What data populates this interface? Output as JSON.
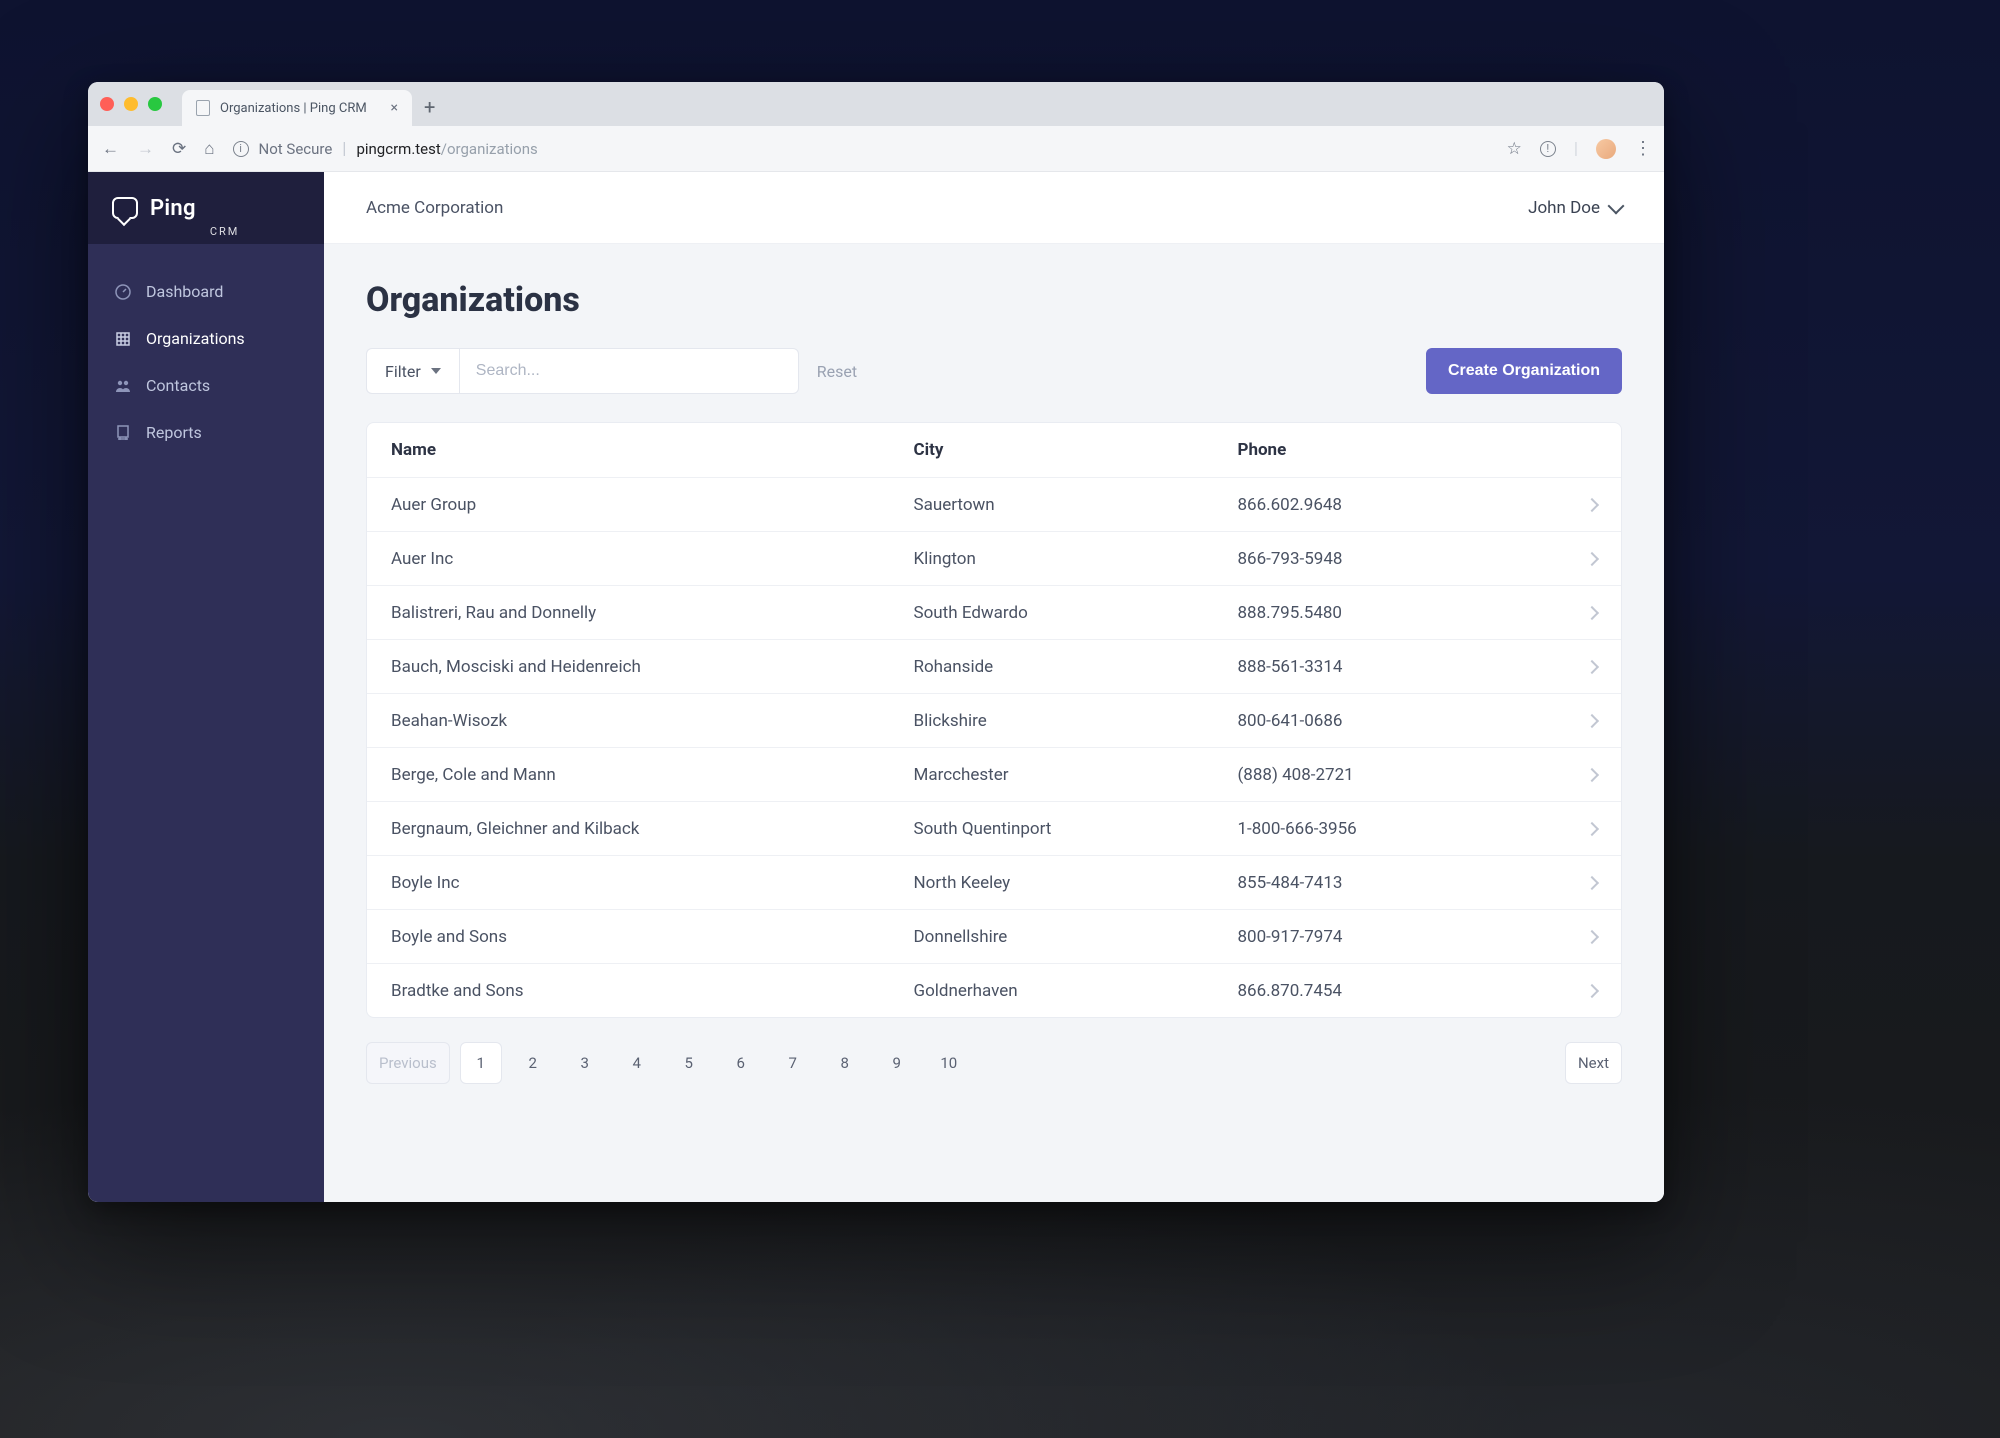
{
  "browser": {
    "tab_title": "Organizations | Ping CRM",
    "not_secure_label": "Not Secure",
    "url_host": "pingcrm.test",
    "url_path": "/organizations"
  },
  "brand": {
    "name": "Ping",
    "suffix": "CRM"
  },
  "sidebar": {
    "items": [
      {
        "label": "Dashboard"
      },
      {
        "label": "Organizations"
      },
      {
        "label": "Contacts"
      },
      {
        "label": "Reports"
      }
    ]
  },
  "topbar": {
    "account": "Acme Corporation",
    "user": "John Doe"
  },
  "page": {
    "title": "Organizations",
    "filter_label": "Filter",
    "search_placeholder": "Search...",
    "reset_label": "Reset",
    "create_label": "Create Organization"
  },
  "table": {
    "headers": {
      "name": "Name",
      "city": "City",
      "phone": "Phone"
    },
    "rows": [
      {
        "name": "Auer Group",
        "city": "Sauertown",
        "phone": "866.602.9648"
      },
      {
        "name": "Auer Inc",
        "city": "Klington",
        "phone": "866-793-5948"
      },
      {
        "name": "Balistreri, Rau and Donnelly",
        "city": "South Edwardo",
        "phone": "888.795.5480"
      },
      {
        "name": "Bauch, Mosciski and Heidenreich",
        "city": "Rohanside",
        "phone": "888-561-3314"
      },
      {
        "name": "Beahan-Wisozk",
        "city": "Blickshire",
        "phone": "800-641-0686"
      },
      {
        "name": "Berge, Cole and Mann",
        "city": "Marcchester",
        "phone": "(888) 408-2721"
      },
      {
        "name": "Bergnaum, Gleichner and Kilback",
        "city": "South Quentinport",
        "phone": "1-800-666-3956"
      },
      {
        "name": "Boyle Inc",
        "city": "North Keeley",
        "phone": "855-484-7413"
      },
      {
        "name": "Boyle and Sons",
        "city": "Donnellshire",
        "phone": "800-917-7974"
      },
      {
        "name": "Bradtke and Sons",
        "city": "Goldnerhaven",
        "phone": "866.870.7454"
      }
    ]
  },
  "pagination": {
    "previous_label": "Previous",
    "next_label": "Next",
    "pages": [
      "1",
      "2",
      "3",
      "4",
      "5",
      "6",
      "7",
      "8",
      "9",
      "10"
    ],
    "current": "1"
  }
}
